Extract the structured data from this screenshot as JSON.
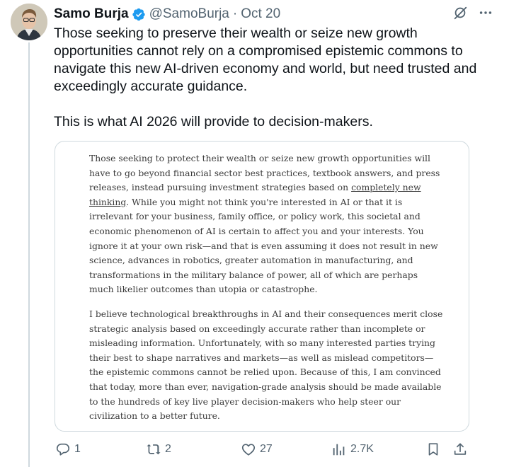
{
  "author": {
    "display_name": "Samo Burja",
    "handle": "@SamoBurja",
    "separator": "·",
    "date": "Oct 20"
  },
  "tweet": {
    "paragraph1": "Those seeking to preserve their wealth or seize new growth opportunities cannot rely on a compromised epistemic commons to navigate this new AI-driven economy and world, but need trusted and exceedingly accurate guidance.",
    "paragraph2": "This is what AI 2026 will provide to decision-makers."
  },
  "image_text": {
    "p1_before_link": "Those seeking to protect their wealth or seize new growth opportunities will have to go beyond financial sector best practices, textbook answers, and press releases, instead pursuing investment strategies based on ",
    "p1_link": "completely new thinking",
    "p1_after_link": ". While you might not think you're interested in AI or that it is irrelevant for your business, family office, or policy work, this societal and economic phenomenon of AI is certain to affect you and your interests. You ignore it at your own risk—and that is even assuming it does not result in new science, advances in robotics, greater automation in manufacturing, and transformations in the military balance of power, all of which are perhaps much likelier outcomes than utopia or catastrophe.",
    "p2": "I believe technological breakthroughs in AI and their consequences merit close strategic analysis based on exceedingly accurate rather than incomplete or misleading information. Unfortunately, with so many interested parties trying their best to shape narratives and markets—as well as mislead competitors—the epistemic commons cannot be relied upon. Because of this, I am convinced that today, more than ever, navigation-grade analysis should be made available to the hundreds of key live player decision-makers who help steer our civilization to a better future."
  },
  "actions": {
    "replies": "1",
    "reposts": "2",
    "likes": "27",
    "views": "2.7K"
  },
  "colors": {
    "text": "#0f1419",
    "secondary": "#536471",
    "verified": "#1d9bf0",
    "border": "#cfd9de"
  },
  "icons": [
    "verified-badge-icon",
    "grok-icon",
    "more-icon",
    "reply-icon",
    "repost-icon",
    "like-icon",
    "views-icon",
    "bookmark-icon",
    "share-icon"
  ]
}
